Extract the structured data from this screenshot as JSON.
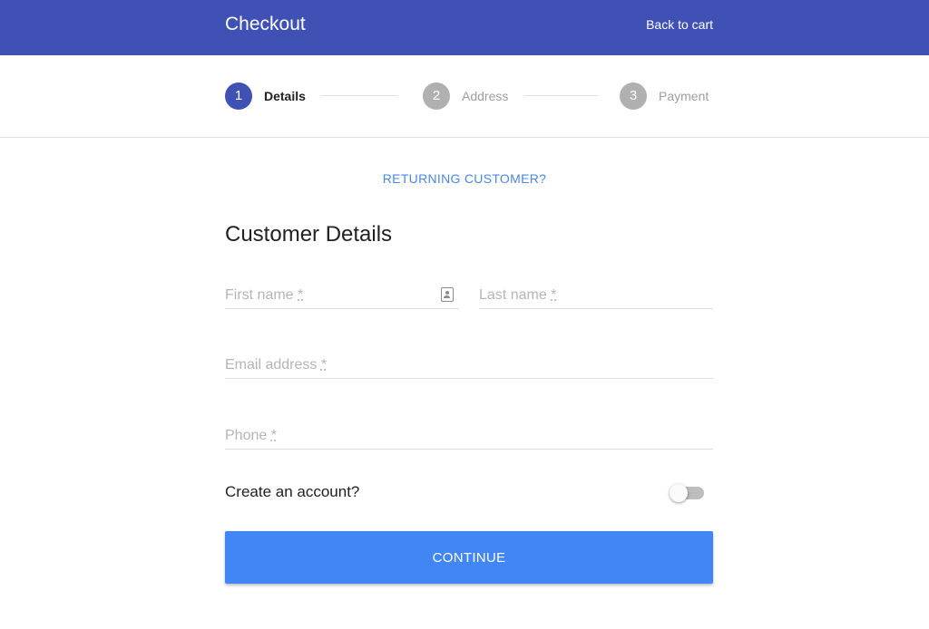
{
  "header": {
    "title": "Checkout",
    "back_link": "Back to cart"
  },
  "stepper": {
    "steps": [
      {
        "number": "1",
        "label": "Details",
        "state": "active"
      },
      {
        "number": "2",
        "label": "Address",
        "state": "inactive"
      },
      {
        "number": "3",
        "label": "Payment",
        "state": "inactive"
      }
    ]
  },
  "returning_customer": "RETURNING CUSTOMER?",
  "form": {
    "title": "Customer Details",
    "first_name": {
      "label": "First name",
      "required_mark": "*",
      "value": ""
    },
    "last_name": {
      "label": "Last name",
      "required_mark": "*",
      "value": ""
    },
    "email": {
      "label": "Email address",
      "required_mark": "*",
      "value": ""
    },
    "phone": {
      "label": "Phone",
      "required_mark": "*",
      "value": ""
    },
    "create_account": {
      "label": "Create an account?",
      "checked": false
    },
    "continue_label": "CONTINUE"
  },
  "colors": {
    "header": "#3f51b5",
    "active_step": "#3f51b5",
    "inactive_step": "#b0b0b0",
    "link": "#4a86e8",
    "button": "#4285f4"
  },
  "icons": {
    "first_name_field": "contact-card-icon"
  }
}
